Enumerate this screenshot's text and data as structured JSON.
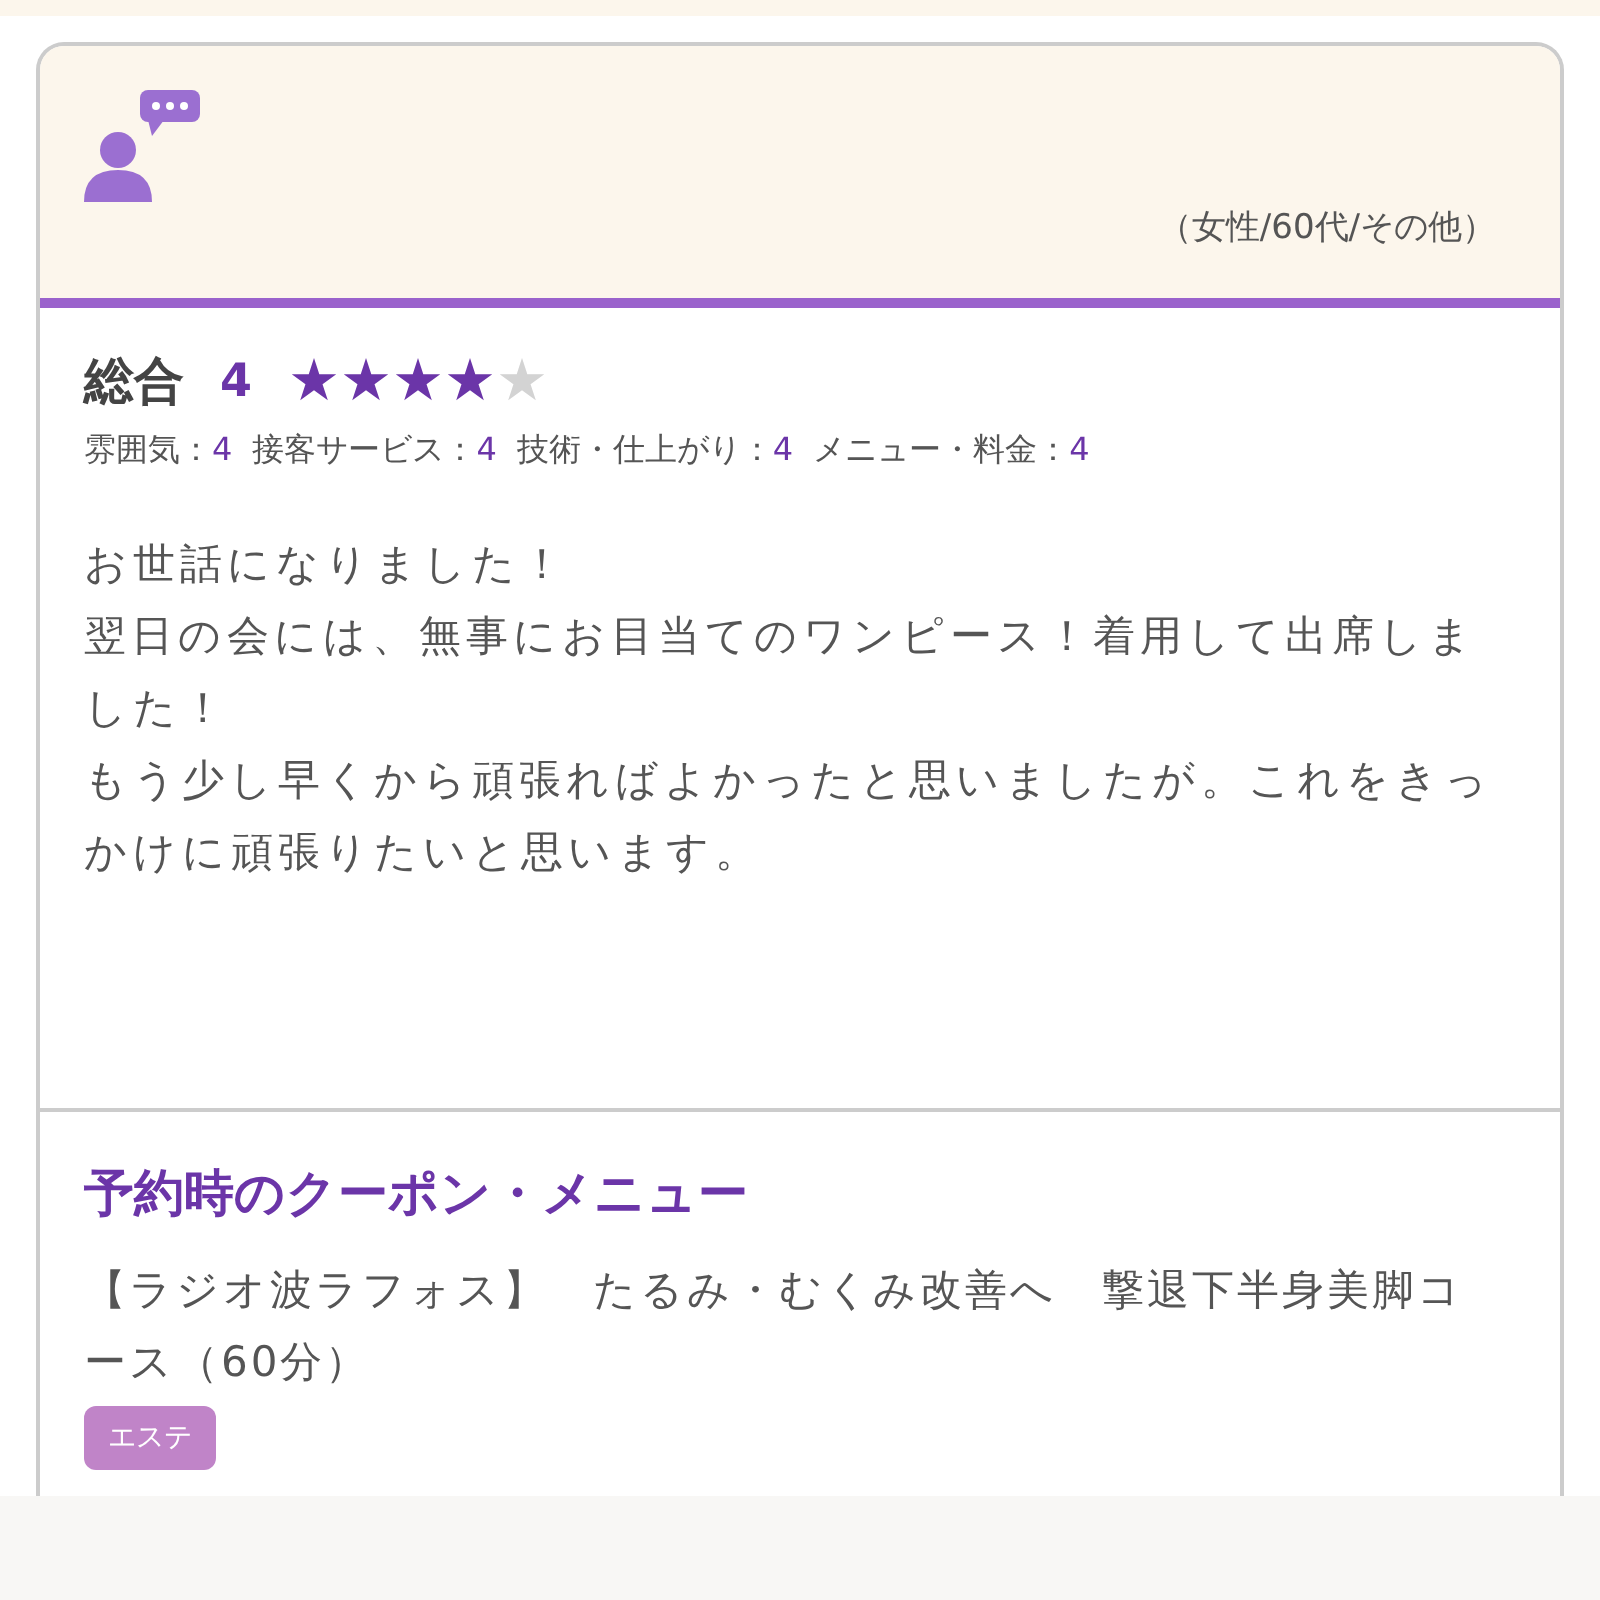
{
  "reviewer": {
    "profile": "（女性/60代/その他）"
  },
  "overall": {
    "label": "総合",
    "score": "4",
    "stars": 4
  },
  "ratings": [
    {
      "label": "雰囲気：",
      "value": "4"
    },
    {
      "label": "接客サービス：",
      "value": "4"
    },
    {
      "label": "技術・仕上がり：",
      "value": "4"
    },
    {
      "label": "メニュー・料金：",
      "value": "4"
    }
  ],
  "review_paragraphs": [
    "お世話になりました！",
    "翌日の会には、無事にお目当てのワンピース！着用して出席しました！",
    "もう少し早くから頑張ればよかったと思いましたが。これをきっかけに頑張りたいと思います。"
  ],
  "coupon": {
    "heading": "予約時のクーポン・メニュー",
    "name": "【ラジオ波ラフォス】　たるみ・むくみ改善へ　撃退下半身美脚コース（60分）",
    "tag": "エステ"
  }
}
